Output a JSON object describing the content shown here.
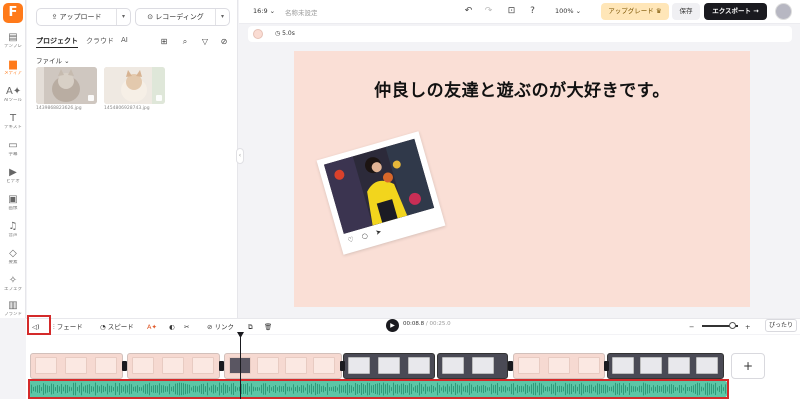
{
  "rail": {
    "items": [
      {
        "label": "テンプレ",
        "icon": "template-icon"
      },
      {
        "label": "メディア",
        "icon": "media-icon"
      },
      {
        "label": "AIツール",
        "icon": "ai-tools-icon"
      },
      {
        "label": "テキスト",
        "icon": "text-icon"
      },
      {
        "label": "字幕",
        "icon": "subtitle-icon"
      },
      {
        "label": "ビデオ",
        "icon": "video-icon"
      },
      {
        "label": "画像",
        "icon": "image-icon"
      },
      {
        "label": "音声",
        "icon": "audio-icon"
      },
      {
        "label": "要素",
        "icon": "elements-icon"
      },
      {
        "label": "エフェク",
        "icon": "effects-icon"
      },
      {
        "label": "ブランド",
        "icon": "brand-icon"
      }
    ]
  },
  "panel": {
    "upload_label": "アップロード",
    "record_label": "レコーディング",
    "tabs": [
      "プロジェクト",
      "クラウド",
      "AI"
    ],
    "filter_label": "ファイル",
    "files": [
      {
        "name": "1439868823626.jpg"
      },
      {
        "name": "1454806928743.jpg"
      }
    ]
  },
  "topbar": {
    "aspect_ratio": "16:9",
    "doc_name": "名称未設定",
    "zoom": "100%",
    "upgrade_label": "アップグレード",
    "save_label": "保存",
    "export_label": "エクスポート →"
  },
  "timing": {
    "duration": "5.0s",
    "swatch_color": "#fadcd3"
  },
  "canvas": {
    "background": "#fadfd6",
    "headline": "仲良しの友達と遊ぶのが大好きです。",
    "photo_icons": "♡ ○ ➤"
  },
  "toolbar": {
    "fade_label": "フェード",
    "speed_label": "スピード",
    "link_label": "リンク",
    "current_time": "00:08.8",
    "separator": " / ",
    "total_time": "00:25.0",
    "fit_label": "ぴったり",
    "zoom_level": 0.85
  },
  "timeline": {
    "clips": [
      {
        "style": "pink"
      },
      {
        "style": "pink"
      },
      {
        "style": "pink"
      },
      {
        "style": "dark"
      },
      {
        "style": "dark"
      },
      {
        "style": "pink"
      },
      {
        "style": "dark"
      }
    ],
    "add_label": "+"
  }
}
